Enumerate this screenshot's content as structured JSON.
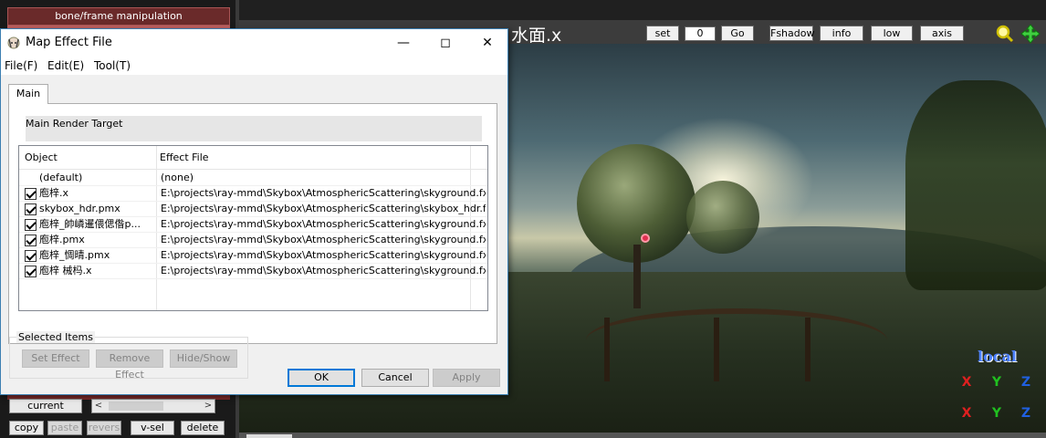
{
  "mmd": {
    "bone_header": "bone/frame manipulation",
    "current_label": "current",
    "buttons": {
      "copy": "copy",
      "paste": "paste",
      "revers": "revers",
      "vsel": "v-sel",
      "delete": "delete"
    }
  },
  "viewport": {
    "model_title": "水面.x",
    "set_label": "set",
    "frame_value": "0",
    "go_label": "Go",
    "fshadow_label": "Fshadow",
    "info_label": "info",
    "lowpow_label": "low pow",
    "axis_label": "axis",
    "local_label": "local",
    "icons": [
      "zoom-icon",
      "move-cross-icon",
      "rotate-x-icon",
      "rotate-y-icon",
      "rotate-z-icon",
      "move-x-icon",
      "move-y-icon",
      "move-z-icon"
    ],
    "axis_letters": {
      "x": "X",
      "y": "Y",
      "z": "Z"
    },
    "colors": {
      "x": "#e02020",
      "y": "#20c020",
      "z": "#2060e0",
      "accent": "#2a6fd6"
    }
  },
  "dialog": {
    "title": "Map Effect File",
    "menu": {
      "file": "File(F)",
      "edit": "Edit(E)",
      "tool": "Tool(T)"
    },
    "tab_main": "Main",
    "render_target": "Main Render Target",
    "columns": {
      "object": "Object",
      "effect": "Effect File"
    },
    "rows": [
      {
        "object": "(default)",
        "effect": "(none)",
        "checked": false
      },
      {
        "object": "庖梓.x",
        "effect": "E:\\projects\\ray-mmd\\Skybox\\AtmosphericScattering\\skyground.fx",
        "checked": true
      },
      {
        "object": "skybox_hdr.pmx",
        "effect": "E:\\projects\\ray-mmd\\Skybox\\AtmosphericScattering\\skybox_hdr.fx",
        "checked": true
      },
      {
        "object": "庖梓_帥嶙暹偎偲偺p...",
        "effect": "E:\\projects\\ray-mmd\\Skybox\\AtmosphericScattering\\skyground.fx",
        "checked": true
      },
      {
        "object": "庖梓.pmx",
        "effect": "E:\\projects\\ray-mmd\\Skybox\\AtmosphericScattering\\skyground.fx",
        "checked": true
      },
      {
        "object": "庖梓_惆晴.pmx",
        "effect": "E:\\projects\\ray-mmd\\Skybox\\AtmosphericScattering\\skyground.fx",
        "checked": true
      },
      {
        "object": "庖梓 械杩.x",
        "effect": "E:\\projects\\ray-mmd\\Skybox\\AtmosphericScattering\\skyground.fx",
        "checked": true
      }
    ],
    "selected_items": "Selected Items",
    "buttons": {
      "set_effect": "Set Effect",
      "remove_effect": "Remove Effect",
      "hide_show": "Hide/Show",
      "ok": "OK",
      "cancel": "Cancel",
      "apply": "Apply"
    }
  }
}
